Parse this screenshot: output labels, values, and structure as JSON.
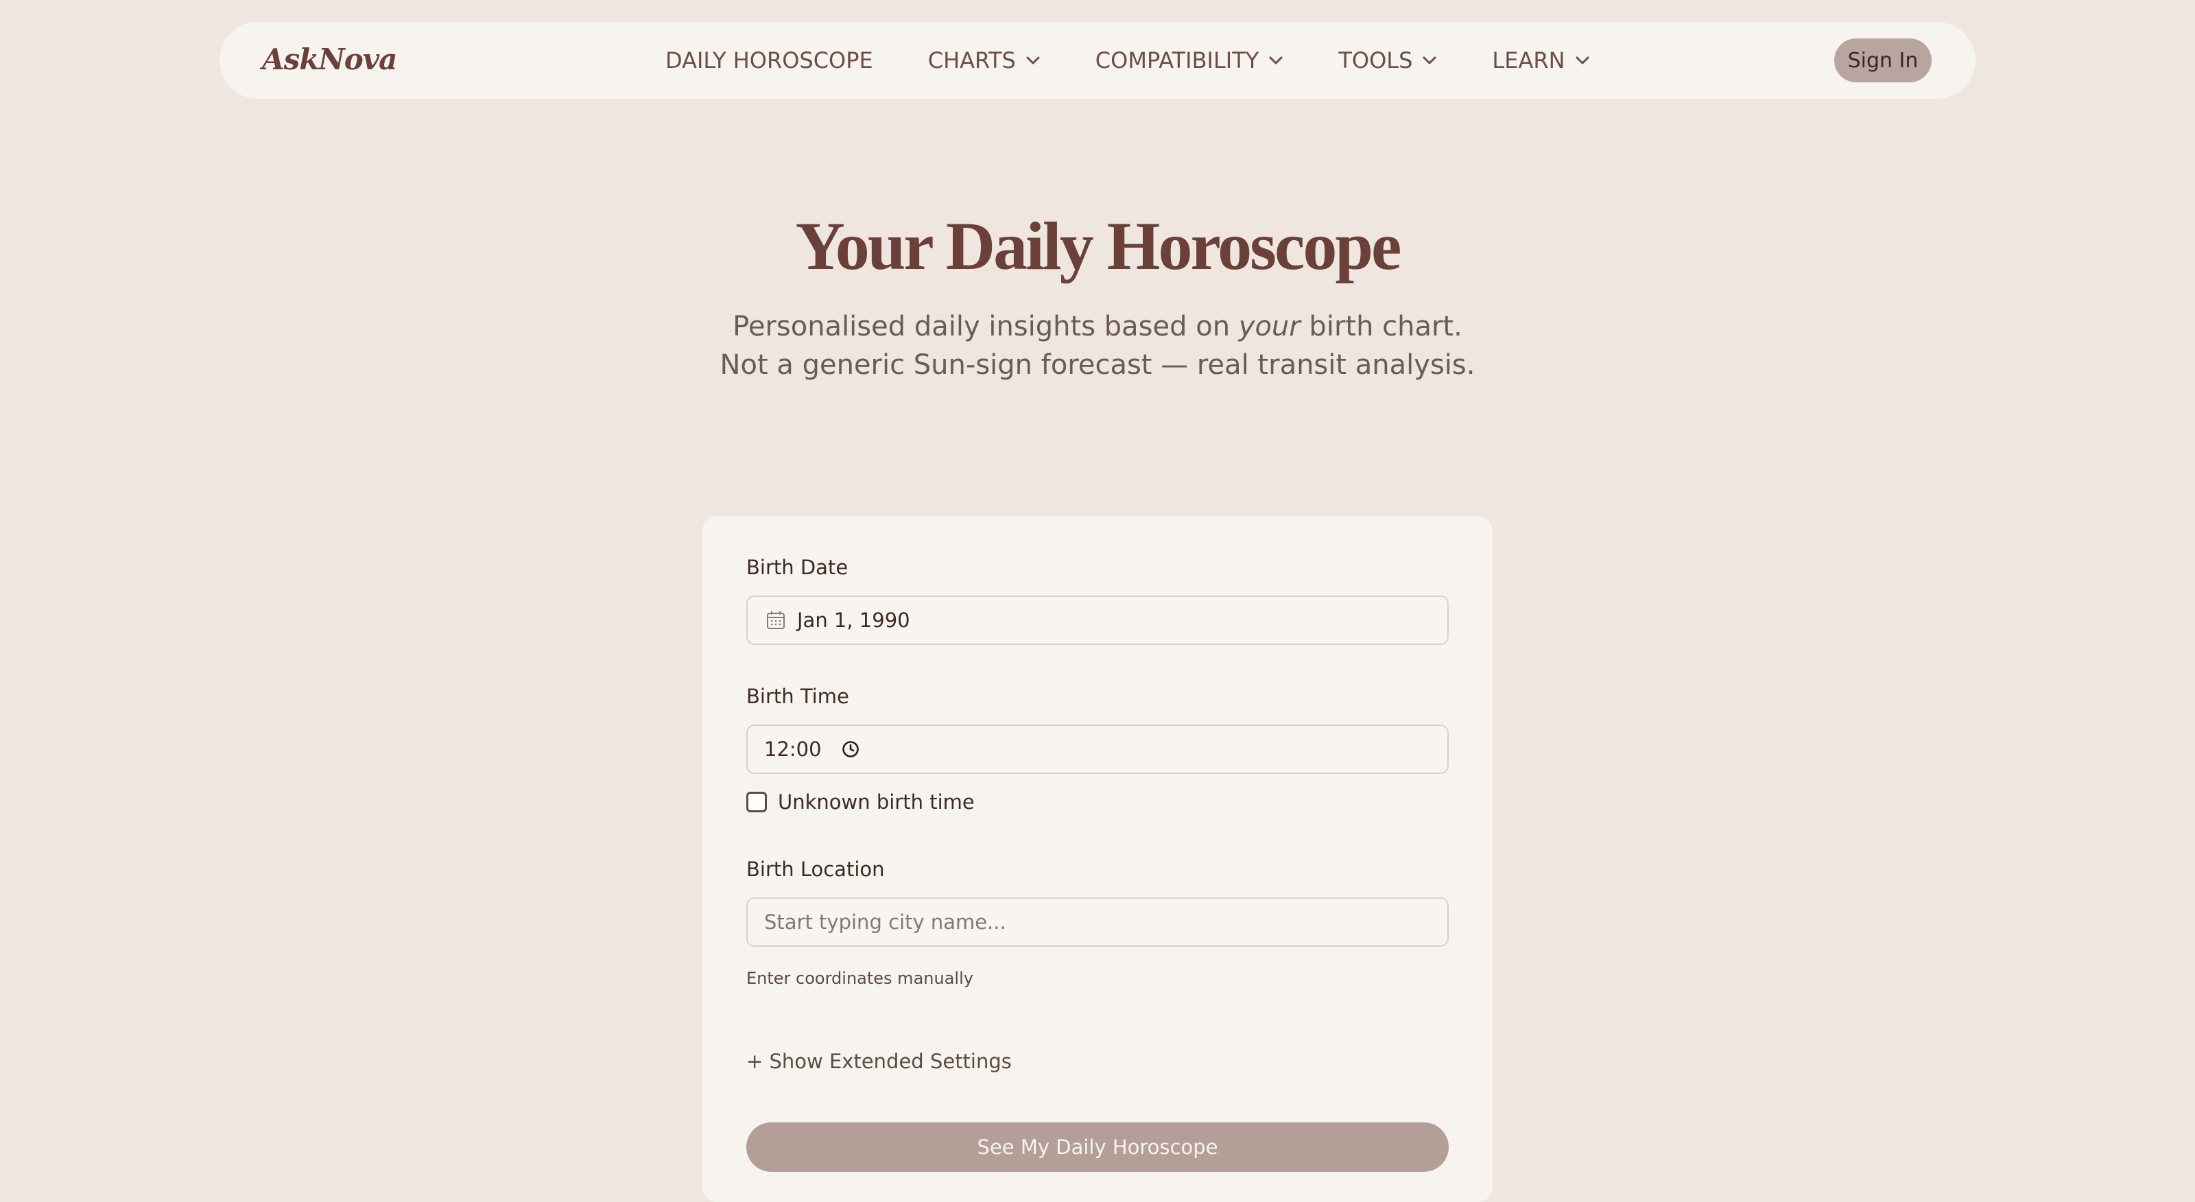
{
  "nav": {
    "logo": "AskNova",
    "items": [
      {
        "label": "DAILY HOROSCOPE",
        "has_dropdown": false
      },
      {
        "label": "CHARTS",
        "has_dropdown": true
      },
      {
        "label": "COMPATIBILITY",
        "has_dropdown": true
      },
      {
        "label": "TOOLS",
        "has_dropdown": true
      },
      {
        "label": "LEARN",
        "has_dropdown": true
      }
    ],
    "sign_in_label": "Sign In",
    "dropdown_icon": "chevron-down-icon"
  },
  "hero": {
    "title": "Your Daily Horoscope",
    "subtitle_line1_before": "Personalised daily insights based on ",
    "subtitle_line1_emphasis": "your",
    "subtitle_line1_after": " birth chart.",
    "subtitle_line2": "Not a generic Sun-sign forecast — real transit analysis."
  },
  "form": {
    "birth_date": {
      "label": "Birth Date",
      "value": "Jan 1, 1990",
      "icon": "calendar-icon"
    },
    "birth_time": {
      "label": "Birth Time",
      "value": "12:00",
      "icon": "clock-icon"
    },
    "unknown_time": {
      "label": "Unknown birth time",
      "checked": false
    },
    "birth_location": {
      "label": "Birth Location",
      "placeholder": "Start typing city name..."
    },
    "manual_coords_link": "Enter coordinates manually",
    "extended_settings_label": "+ Show Extended Settings",
    "submit_label": "See My Daily Horoscope"
  },
  "colors": {
    "page_bg": "#efe7df",
    "nav_bg": "#f7f3ee",
    "brand": "#6b403a",
    "signin_bg": "#b9a59f",
    "card_bg": "#f7f4f0",
    "button_bg": "#b39e98"
  }
}
